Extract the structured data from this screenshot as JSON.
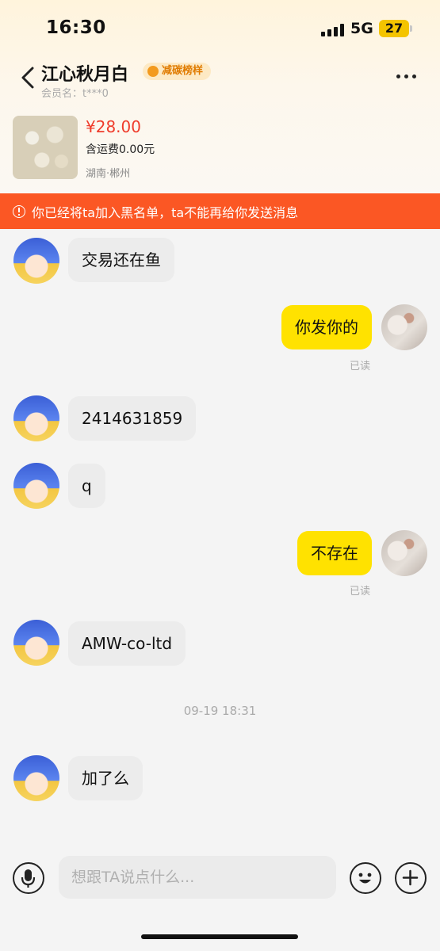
{
  "status_bar": {
    "time": "16:30",
    "network": "5G",
    "battery": "27"
  },
  "header": {
    "title": "江心秋月白",
    "badge": "减碳榜样",
    "member": "会员名：t***0"
  },
  "product": {
    "price": "¥28.00",
    "shipping": "含运费0.00元",
    "location": "湖南·郴州"
  },
  "banner": {
    "text": "你已经将ta加入黑名单，ta不能再给你发送消息"
  },
  "messages": [
    {
      "from": "them",
      "text": "交易还在鱼"
    },
    {
      "from": "me",
      "text": "你发你的",
      "status": "已读"
    },
    {
      "from": "them",
      "text": "2414631859"
    },
    {
      "from": "them",
      "text": "q"
    },
    {
      "from": "me",
      "text": "不存在",
      "status": "已读"
    },
    {
      "from": "them",
      "text": "AMW-co-ltd"
    },
    {
      "from": "them",
      "text": "加了么"
    }
  ],
  "timestamp": "09-19 18:31",
  "input": {
    "placeholder": "想跟TA说点什么..."
  },
  "icons": [
    "back-icon",
    "more-icon",
    "warning-icon",
    "mic-icon",
    "emoji-icon",
    "plus-icon"
  ],
  "colors": {
    "banner": "#fb5724",
    "my_bubble": "#ffe200",
    "price": "#ef3c2b"
  }
}
